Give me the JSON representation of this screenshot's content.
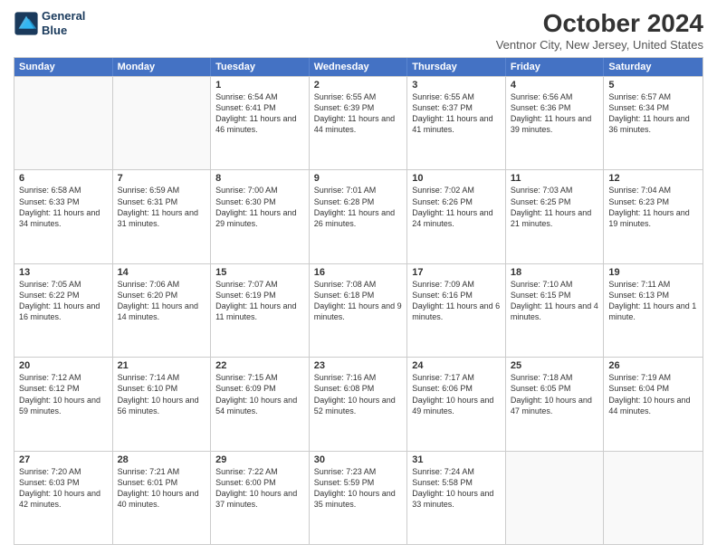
{
  "header": {
    "logo_line1": "General",
    "logo_line2": "Blue",
    "title": "October 2024",
    "subtitle": "Ventnor City, New Jersey, United States"
  },
  "calendar": {
    "days_of_week": [
      "Sunday",
      "Monday",
      "Tuesday",
      "Wednesday",
      "Thursday",
      "Friday",
      "Saturday"
    ],
    "rows": [
      [
        {
          "day": "",
          "info": ""
        },
        {
          "day": "",
          "info": ""
        },
        {
          "day": "1",
          "info": "Sunrise: 6:54 AM\nSunset: 6:41 PM\nDaylight: 11 hours and 46 minutes."
        },
        {
          "day": "2",
          "info": "Sunrise: 6:55 AM\nSunset: 6:39 PM\nDaylight: 11 hours and 44 minutes."
        },
        {
          "day": "3",
          "info": "Sunrise: 6:55 AM\nSunset: 6:37 PM\nDaylight: 11 hours and 41 minutes."
        },
        {
          "day": "4",
          "info": "Sunrise: 6:56 AM\nSunset: 6:36 PM\nDaylight: 11 hours and 39 minutes."
        },
        {
          "day": "5",
          "info": "Sunrise: 6:57 AM\nSunset: 6:34 PM\nDaylight: 11 hours and 36 minutes."
        }
      ],
      [
        {
          "day": "6",
          "info": "Sunrise: 6:58 AM\nSunset: 6:33 PM\nDaylight: 11 hours and 34 minutes."
        },
        {
          "day": "7",
          "info": "Sunrise: 6:59 AM\nSunset: 6:31 PM\nDaylight: 11 hours and 31 minutes."
        },
        {
          "day": "8",
          "info": "Sunrise: 7:00 AM\nSunset: 6:30 PM\nDaylight: 11 hours and 29 minutes."
        },
        {
          "day": "9",
          "info": "Sunrise: 7:01 AM\nSunset: 6:28 PM\nDaylight: 11 hours and 26 minutes."
        },
        {
          "day": "10",
          "info": "Sunrise: 7:02 AM\nSunset: 6:26 PM\nDaylight: 11 hours and 24 minutes."
        },
        {
          "day": "11",
          "info": "Sunrise: 7:03 AM\nSunset: 6:25 PM\nDaylight: 11 hours and 21 minutes."
        },
        {
          "day": "12",
          "info": "Sunrise: 7:04 AM\nSunset: 6:23 PM\nDaylight: 11 hours and 19 minutes."
        }
      ],
      [
        {
          "day": "13",
          "info": "Sunrise: 7:05 AM\nSunset: 6:22 PM\nDaylight: 11 hours and 16 minutes."
        },
        {
          "day": "14",
          "info": "Sunrise: 7:06 AM\nSunset: 6:20 PM\nDaylight: 11 hours and 14 minutes."
        },
        {
          "day": "15",
          "info": "Sunrise: 7:07 AM\nSunset: 6:19 PM\nDaylight: 11 hours and 11 minutes."
        },
        {
          "day": "16",
          "info": "Sunrise: 7:08 AM\nSunset: 6:18 PM\nDaylight: 11 hours and 9 minutes."
        },
        {
          "day": "17",
          "info": "Sunrise: 7:09 AM\nSunset: 6:16 PM\nDaylight: 11 hours and 6 minutes."
        },
        {
          "day": "18",
          "info": "Sunrise: 7:10 AM\nSunset: 6:15 PM\nDaylight: 11 hours and 4 minutes."
        },
        {
          "day": "19",
          "info": "Sunrise: 7:11 AM\nSunset: 6:13 PM\nDaylight: 11 hours and 1 minute."
        }
      ],
      [
        {
          "day": "20",
          "info": "Sunrise: 7:12 AM\nSunset: 6:12 PM\nDaylight: 10 hours and 59 minutes."
        },
        {
          "day": "21",
          "info": "Sunrise: 7:14 AM\nSunset: 6:10 PM\nDaylight: 10 hours and 56 minutes."
        },
        {
          "day": "22",
          "info": "Sunrise: 7:15 AM\nSunset: 6:09 PM\nDaylight: 10 hours and 54 minutes."
        },
        {
          "day": "23",
          "info": "Sunrise: 7:16 AM\nSunset: 6:08 PM\nDaylight: 10 hours and 52 minutes."
        },
        {
          "day": "24",
          "info": "Sunrise: 7:17 AM\nSunset: 6:06 PM\nDaylight: 10 hours and 49 minutes."
        },
        {
          "day": "25",
          "info": "Sunrise: 7:18 AM\nSunset: 6:05 PM\nDaylight: 10 hours and 47 minutes."
        },
        {
          "day": "26",
          "info": "Sunrise: 7:19 AM\nSunset: 6:04 PM\nDaylight: 10 hours and 44 minutes."
        }
      ],
      [
        {
          "day": "27",
          "info": "Sunrise: 7:20 AM\nSunset: 6:03 PM\nDaylight: 10 hours and 42 minutes."
        },
        {
          "day": "28",
          "info": "Sunrise: 7:21 AM\nSunset: 6:01 PM\nDaylight: 10 hours and 40 minutes."
        },
        {
          "day": "29",
          "info": "Sunrise: 7:22 AM\nSunset: 6:00 PM\nDaylight: 10 hours and 37 minutes."
        },
        {
          "day": "30",
          "info": "Sunrise: 7:23 AM\nSunset: 5:59 PM\nDaylight: 10 hours and 35 minutes."
        },
        {
          "day": "31",
          "info": "Sunrise: 7:24 AM\nSunset: 5:58 PM\nDaylight: 10 hours and 33 minutes."
        },
        {
          "day": "",
          "info": ""
        },
        {
          "day": "",
          "info": ""
        }
      ]
    ]
  }
}
